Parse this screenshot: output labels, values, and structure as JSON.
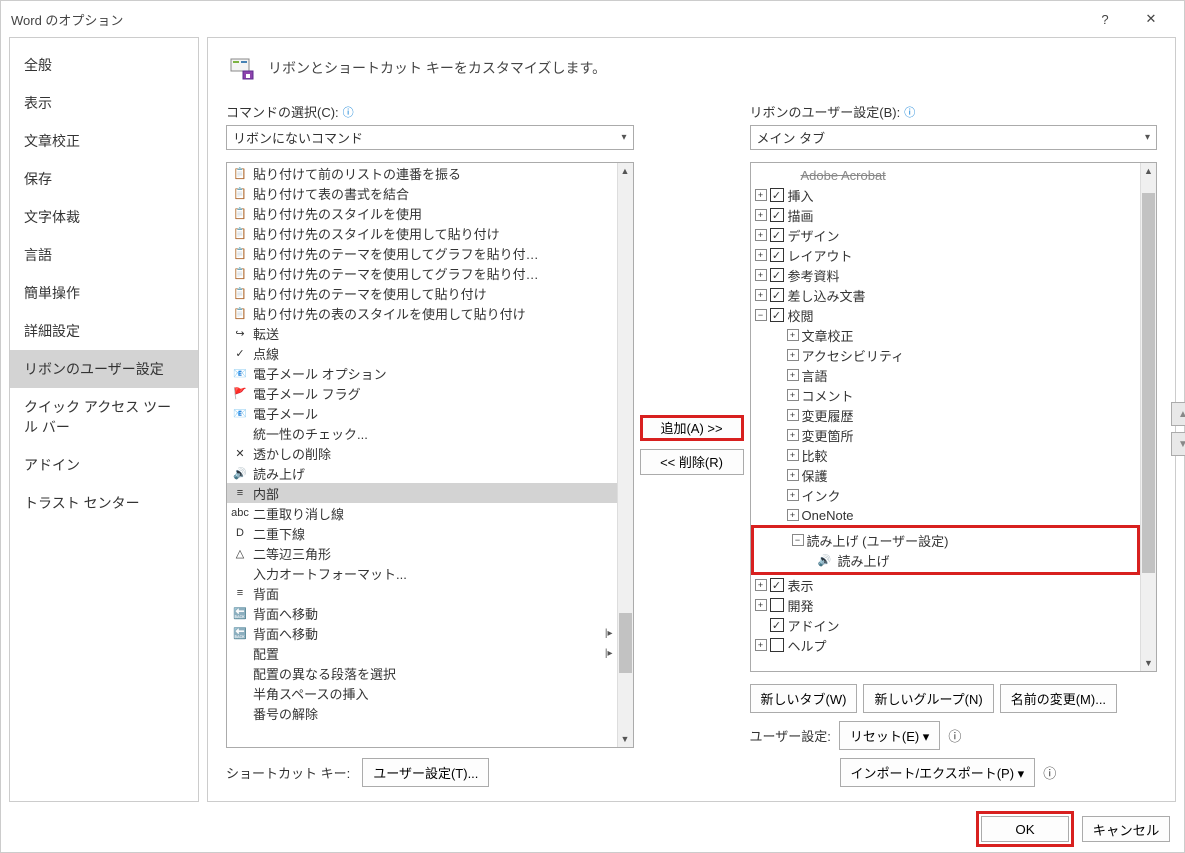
{
  "title": "Word のオプション",
  "sidebar": {
    "items": [
      {
        "label": "全般"
      },
      {
        "label": "表示"
      },
      {
        "label": "文章校正"
      },
      {
        "label": "保存"
      },
      {
        "label": "文字体裁"
      },
      {
        "label": "言語"
      },
      {
        "label": "簡単操作"
      },
      {
        "label": "詳細設定"
      },
      {
        "label": "リボンのユーザー設定",
        "selected": true
      },
      {
        "label": "クイック アクセス ツール バー"
      },
      {
        "label": "アドイン"
      },
      {
        "label": "トラスト センター"
      }
    ]
  },
  "header": {
    "text": "リボンとショートカット キーをカスタマイズします。"
  },
  "left": {
    "label": "コマンドの選択(C):",
    "dropdown": "リボンにないコマンド",
    "commands": [
      {
        "icon": "📋",
        "label": "貼り付けて前のリストの連番を振る"
      },
      {
        "icon": "📋",
        "label": "貼り付けて表の書式を結合"
      },
      {
        "icon": "📋",
        "label": "貼り付け先のスタイルを使用"
      },
      {
        "icon": "📋",
        "label": "貼り付け先のスタイルを使用して貼り付け"
      },
      {
        "icon": "📋",
        "label": "貼り付け先のテーマを使用してグラフを貼り付…"
      },
      {
        "icon": "📋",
        "label": "貼り付け先のテーマを使用してグラフを貼り付…"
      },
      {
        "icon": "📋",
        "label": "貼り付け先のテーマを使用して貼り付け"
      },
      {
        "icon": "📋",
        "label": "貼り付け先の表のスタイルを使用して貼り付け"
      },
      {
        "icon": "↪",
        "label": "転送"
      },
      {
        "icon": "✓",
        "label": "点線"
      },
      {
        "icon": "📧",
        "label": "電子メール オプション"
      },
      {
        "icon": "🚩",
        "label": "電子メール フラグ"
      },
      {
        "icon": "📧",
        "label": "電子メール"
      },
      {
        "icon": "",
        "label": "統一性のチェック..."
      },
      {
        "icon": "✕",
        "label": "透かしの削除"
      },
      {
        "icon": "🔊",
        "label": "読み上げ"
      },
      {
        "icon": "≡",
        "label": "内部",
        "selected": true
      },
      {
        "icon": "abc",
        "label": "二重取り消し線"
      },
      {
        "icon": "D",
        "label": "二重下線"
      },
      {
        "icon": "△",
        "label": "二等辺三角形"
      },
      {
        "icon": "",
        "label": "入力オートフォーマット..."
      },
      {
        "icon": "≡",
        "label": "背面"
      },
      {
        "icon": "🔙",
        "label": "背面へ移動"
      },
      {
        "icon": "🔙",
        "label": "背面へ移動",
        "sub": true
      },
      {
        "icon": "",
        "label": "配置",
        "sub": true
      },
      {
        "icon": "",
        "label": "配置の異なる段落を選択"
      },
      {
        "icon": "",
        "label": "半角スペースの挿入"
      },
      {
        "icon": "",
        "label": "番号の解除"
      }
    ],
    "shortcut_label": "ショートカット キー:",
    "shortcut_btn": "ユーザー設定(T)..."
  },
  "mid": {
    "add": "追加(A) >>",
    "remove": "<< 削除(R)"
  },
  "right": {
    "label": "リボンのユーザー設定(B):",
    "dropdown": "メイン タブ",
    "tree": [
      {
        "indent": 1,
        "expand": "+",
        "check": true,
        "label": "挿入"
      },
      {
        "indent": 1,
        "expand": "+",
        "check": true,
        "label": "描画"
      },
      {
        "indent": 1,
        "expand": "+",
        "check": true,
        "label": "デザイン"
      },
      {
        "indent": 1,
        "expand": "+",
        "check": true,
        "label": "レイアウト"
      },
      {
        "indent": 1,
        "expand": "+",
        "check": true,
        "label": "参考資料"
      },
      {
        "indent": 1,
        "expand": "+",
        "check": true,
        "label": "差し込み文書"
      },
      {
        "indent": 1,
        "expand": "−",
        "check": true,
        "label": "校閲"
      },
      {
        "indent": 2,
        "expand": "+",
        "label": "文章校正"
      },
      {
        "indent": 2,
        "expand": "+",
        "label": "アクセシビリティ"
      },
      {
        "indent": 2,
        "expand": "+",
        "label": "言語"
      },
      {
        "indent": 2,
        "expand": "+",
        "label": "コメント"
      },
      {
        "indent": 2,
        "expand": "+",
        "label": "変更履歴"
      },
      {
        "indent": 2,
        "expand": "+",
        "label": "変更箇所"
      },
      {
        "indent": 2,
        "expand": "+",
        "label": "比較"
      },
      {
        "indent": 2,
        "expand": "+",
        "label": "保護"
      },
      {
        "indent": 2,
        "expand": "+",
        "label": "インク"
      },
      {
        "indent": 2,
        "expand": "+",
        "label": "OneNote"
      }
    ],
    "custom_group": {
      "label": "読み上げ (ユーザー設定)",
      "item": "読み上げ"
    },
    "tree2": [
      {
        "indent": 1,
        "expand": "+",
        "check": true,
        "label": "表示"
      },
      {
        "indent": 1,
        "expand": "+",
        "check": false,
        "label": "開発"
      },
      {
        "indent": 1,
        "nocollapse": true,
        "check": true,
        "label": "アドイン"
      },
      {
        "indent": 1,
        "expand": "+",
        "check": false,
        "label": "ヘルプ"
      }
    ],
    "new_tab": "新しいタブ(W)",
    "new_group": "新しいグループ(N)",
    "rename": "名前の変更(M)...",
    "user_label": "ユーザー設定:",
    "reset": "リセット(E) ▾",
    "import_export": "インポート/エクスポート(P) ▾"
  },
  "footer": {
    "ok": "OK",
    "cancel": "キャンセル"
  }
}
